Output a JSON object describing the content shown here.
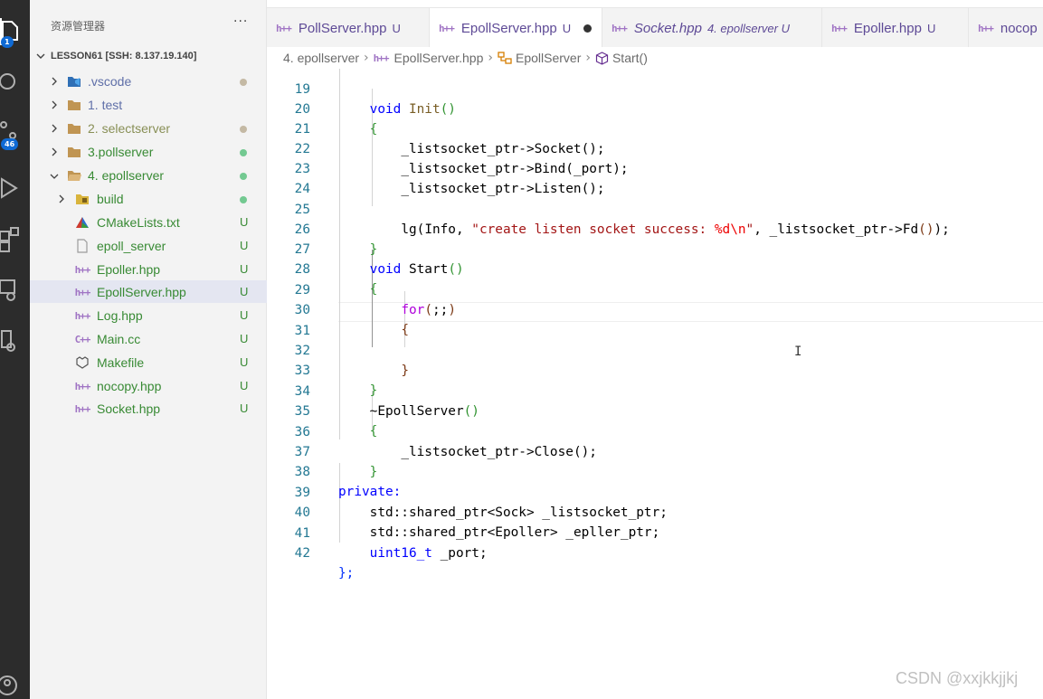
{
  "activity_bar": {
    "explorer_badge": "1",
    "scm_badge": "46"
  },
  "explorer": {
    "title": "资源管理器",
    "more_label": "···",
    "workspace": "LESSON61 [SSH: 8.137.19.140]",
    "items": [
      {
        "label": ".vscode",
        "status": "dot",
        "color": "#5f6fa8"
      },
      {
        "label": "1. test",
        "status": "",
        "color": "#5f6fa8"
      },
      {
        "label": "2. selectserver",
        "status": "dot",
        "color": "#888f56"
      },
      {
        "label": "3.pollserver",
        "status": "dot",
        "color": "#388a34"
      },
      {
        "label": "4. epollserver",
        "status": "dot",
        "color": "#388a34"
      },
      {
        "label": "build",
        "status": "dot",
        "color": "#388a34"
      },
      {
        "label": "CMakeLists.txt",
        "status": "U",
        "color": "#388a34"
      },
      {
        "label": "epoll_server",
        "status": "U",
        "color": "#388a34"
      },
      {
        "label": "Epoller.hpp",
        "status": "U",
        "color": "#388a34"
      },
      {
        "label": "EpollServer.hpp",
        "status": "U",
        "color": "#388a34"
      },
      {
        "label": "Log.hpp",
        "status": "U",
        "color": "#388a34"
      },
      {
        "label": "Main.cc",
        "status": "U",
        "color": "#388a34"
      },
      {
        "label": "Makefile",
        "status": "U",
        "color": "#388a34"
      },
      {
        "label": "nocopy.hpp",
        "status": "U",
        "color": "#388a34"
      },
      {
        "label": "Socket.hpp",
        "status": "U",
        "color": "#388a34"
      }
    ]
  },
  "tabs": [
    {
      "name": "PollServer.hpp",
      "status": "U"
    },
    {
      "name": "EpollServer.hpp",
      "status": "U"
    },
    {
      "name": "Socket.hpp",
      "status": "4. epollserver U"
    },
    {
      "name": "Epoller.hpp",
      "status": "U"
    },
    {
      "name": "nocop",
      "status": ""
    }
  ],
  "breadcrumb": {
    "folder": "4. epollserver",
    "file": "EpollServer.hpp",
    "class": "EpollServer",
    "method": "Start()"
  },
  "code": {
    "line_numbers": [
      "19",
      "20",
      "21",
      "22",
      "23",
      "24",
      "25",
      "26",
      "27",
      "28",
      "29",
      "30",
      "31",
      "32",
      "33",
      "34",
      "35",
      "36",
      "37",
      "38",
      "39",
      "40",
      "41",
      "42"
    ],
    "partial_line": "    void Init()",
    "l20": "{",
    "l21a": "_listsocket_ptr",
    "l21b": "->",
    "l21c": "Socket",
    "l21d": "();",
    "l22a": "_listsocket_ptr",
    "l22b": "->",
    "l22c": "Bind",
    "l22d": "(",
    "l22e": "_port",
    "l22f": ");",
    "l23a": "_listsocket_ptr",
    "l23b": "->",
    "l23c": "Listen",
    "l23d": "();",
    "l25a": "lg",
    "l25b": "(",
    "l25c": "Info",
    "l25d": ", ",
    "l25e": "\"create listen socket success: ",
    "l25f": "%d\\n",
    "l25g": "\"",
    "l25h": ", ",
    "l25i": "_listsocket_ptr",
    "l25j": "->",
    "l25k": "Fd",
    "l25l": "()",
    "l25m": ");",
    "l26": "}",
    "l27a": "void",
    "l27b": "Start",
    "l27c": "()",
    "l28": "{",
    "l29a": "for",
    "l29b": "(",
    "l29c": ";;",
    "l29d": ")",
    "l30": "{",
    "l32": "}",
    "l33": "}",
    "l34a": "~",
    "l34b": "EpollServer",
    "l34c": "()",
    "l35": "{",
    "l36a": "_listsocket_ptr",
    "l36b": "->",
    "l36c": "Close",
    "l36d": "();",
    "l37": "}",
    "l38": "private:",
    "l39a": "std::",
    "l39b": "shared_ptr",
    "l39c": "<",
    "l39d": "Sock",
    "l39e": ">",
    "l39f": " _listsocket_ptr;",
    "l40a": "std::",
    "l40b": "shared_ptr",
    "l40c": "<",
    "l40d": "Epoller",
    "l40e": ">",
    "l40f": " _epller_ptr;",
    "l41a": "uint16_t",
    "l41b": " _port;",
    "l42": "};"
  },
  "watermark": "CSDN @xxjkkjjkj"
}
